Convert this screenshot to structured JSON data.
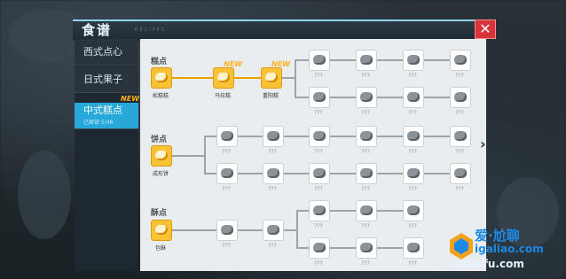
{
  "header": {
    "title": "食谱",
    "title_sub": "RECIPES",
    "close_label": "✕"
  },
  "sidebar": {
    "tabs": [
      {
        "label": "西式点心"
      },
      {
        "label": "日式果子"
      },
      {
        "label": "中式糕点",
        "sub": "已解锁 5/48"
      }
    ],
    "new_badge": "NEW"
  },
  "categories": [
    {
      "label": "糕点"
    },
    {
      "label": "饼点"
    },
    {
      "label": "酥点"
    }
  ],
  "unlocked_items": [
    {
      "name": "松糕糕"
    },
    {
      "name": "马拉糕"
    },
    {
      "name": "重阳糕"
    },
    {
      "name": "成形饼"
    },
    {
      "name": "包酥"
    }
  ],
  "locked_label": "???",
  "new_markers": [
    "NEW",
    "NEW"
  ],
  "more_arrow": "›",
  "watermark": {
    "text": "爱·尬聊",
    "url": "igaliao.com",
    "url2": "qkuufu.com"
  }
}
